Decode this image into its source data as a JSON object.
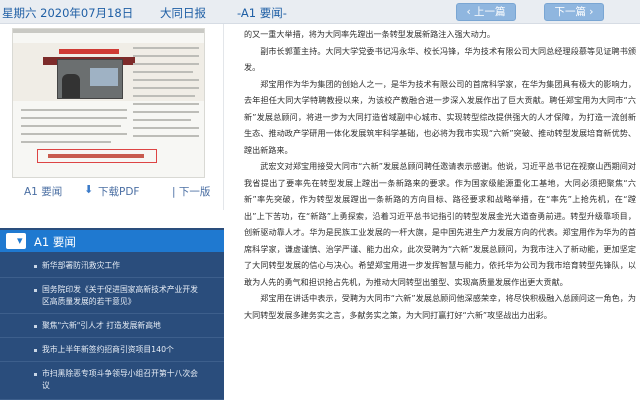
{
  "header": {
    "date": "星期六 2020年07月18日",
    "paper_name": "大同日报",
    "page_label": "-A1 要闻-",
    "prev_button": "上一篇",
    "next_button": "下一篇"
  },
  "preview": {
    "page_link": "A1 要闻",
    "pdf_link": "下载PDF",
    "next_page_link": "| 下一版"
  },
  "article_list": {
    "title": "A1 要闻",
    "items": [
      "新华部署防汛救灾工作",
      "国务院印发《关于促进国家高新技术产业开发区高质量发展的若干意见》",
      "聚焦\"六新\"引人才 打造发展新高地",
      "我市上半年新签约招商引资项目140个",
      "市扫黑除恶专项斗争领导小组召开第十八次会议"
    ]
  },
  "article": {
    "paragraphs": [
      "的又一重大举措，将为大同率先蹚出一条转型发展新路注入强大动力。",
      "副市长郭董主持。大同大学党委书记冯永华、校长冯锋，华为技术有限公司大同总经理段慕等见证聘书颁发。",
      "郑宝用作为华为集团的创始人之一，是华为技术有限公司的首席科学家，在华为集团具有极大的影响力，去年担任大同大学特聘教授以来，为该校产教融合进一步深入发展作出了巨大贡献。聘任郑宝用为大同市“六新”发展总顾问，将进一步为大同打造省域副中心城市、实现转型综改提供强大的人才保障，为打造一流创新生态、推动政产学研用一体化发展筑牢科学基础，也必将为我市实现“六新”突破、推动转型发展培育新优势、蹚出新路来。",
      "武宏文对郑宝用接受大同市“六新”发展总顾问聘任邀请表示感谢。他说，习近平总书记在视察山西期间对我省提出了要率先在转型发展上蹚出一条新路来的要求。作为国家级能源重化工基地，大同必须把聚焦“六新”率先突破，作为转型发展蹚出一条新路的方向目标、路径要求和战略举措，在“率先”上抢先机，在“蹚出”上下苦功，在“新路”上勇探索，沿着习近平总书记指引的转型发展金光大道奋勇前进。转型升级靠项目，创新驱动靠人才。华为是民族工业发展的一杆大旗，是中国先进生产力发展方向的代表。郑宝用作为华为的首席科学家，谦虚谨慎、治学严谨、能力出众，此次受聘为“六新”发展总顾问，为我市注入了新动能，更加坚定了大同转型发展的信心与决心。希望郑宝用进一步发挥智慧与能力，依托华为公司为我市培育转型先锋队，以敢为人先的勇气和担识抢占先机，为推动大同转型出雏型、实现高质量发展作出更大贡献。",
      "郑宝用在讲话中表示，受聘为大同市“六新”发展总顾问他深感荣幸，将尽快积极融入总顾问这一角色，为大同转型发展多建务实之言，多献务实之策，为大同打赢打好“六新”攻坚战出力出彩。"
    ]
  },
  "colors": {
    "header_bg": "#e9edf2",
    "header_text": "#1f5fa5",
    "nav_button": "#8fb6df",
    "list_panel": "#2a4d7c",
    "list_header": "#1f79d0"
  }
}
